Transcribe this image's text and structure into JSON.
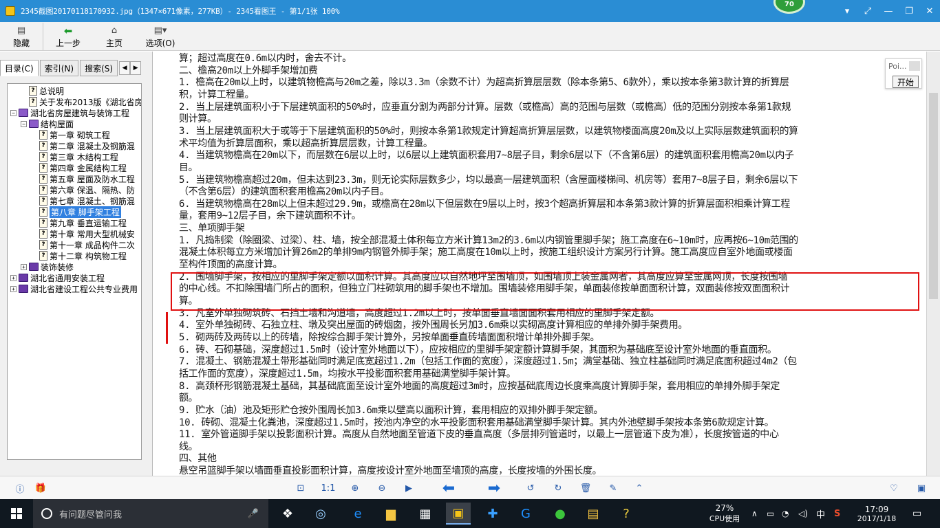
{
  "window": {
    "title": "2345截图20170118170932.jpg（1347×671像素，277KB）- 2345看图王 - 第1/1张 100%",
    "badge": "70",
    "buttons": [
      "▾",
      "⤢",
      "—",
      "❐",
      "✕"
    ]
  },
  "toolbar": [
    {
      "icon": "▤",
      "label": "隐藏"
    },
    {
      "icon": "⬅",
      "label": "上一步"
    },
    {
      "icon": "⌂",
      "label": "主页"
    },
    {
      "icon": "▤▾",
      "label": "选项(O)"
    }
  ],
  "left_tabs": [
    "目录(C)",
    "索引(N)",
    "搜索(S)"
  ],
  "tab_arrows": [
    "◀",
    "▶"
  ],
  "tree": [
    {
      "indent": 1,
      "kind": "q",
      "label": "总说明"
    },
    {
      "indent": 1,
      "kind": "q",
      "label": "关于发布2013版《湖北省房屋"
    },
    {
      "indent": 0,
      "kind": "book",
      "exp": "−",
      "label": "湖北省房屋建筑与装饰工程"
    },
    {
      "indent": 1,
      "kind": "book",
      "exp": "−",
      "label": "结构屋面"
    },
    {
      "indent": 2,
      "kind": "q",
      "label": "第一章  砌筑工程"
    },
    {
      "indent": 2,
      "kind": "q",
      "label": "第二章  混凝土及钢筋混"
    },
    {
      "indent": 2,
      "kind": "q",
      "label": "第三章  木结构工程"
    },
    {
      "indent": 2,
      "kind": "q",
      "label": "第四章  金属结构工程"
    },
    {
      "indent": 2,
      "kind": "q",
      "label": "第五章  屋面及防水工程"
    },
    {
      "indent": 2,
      "kind": "q",
      "label": "第六章  保温、隔热、防"
    },
    {
      "indent": 2,
      "kind": "q",
      "label": "第七章  混凝土、钢筋混"
    },
    {
      "indent": 2,
      "kind": "q",
      "label": "第八章  脚手架工程",
      "selected": true
    },
    {
      "indent": 2,
      "kind": "q",
      "label": "第九章  垂直运输工程"
    },
    {
      "indent": 2,
      "kind": "q",
      "label": "第十章  常用大型机械安"
    },
    {
      "indent": 2,
      "kind": "q",
      "label": "第十一章  成品构件二次"
    },
    {
      "indent": 2,
      "kind": "q",
      "label": "第十二章  构筑物工程"
    },
    {
      "indent": 1,
      "kind": "book",
      "exp": "+",
      "label": "装饰装修"
    },
    {
      "indent": 0,
      "kind": "book",
      "exp": "+",
      "label": "湖北省通用安装工程"
    },
    {
      "indent": 0,
      "kind": "book",
      "exp": "+",
      "label": "湖北省建设工程公共专业费用"
    }
  ],
  "doc_lines": [
    "算；超过高度在0.6m以内时，舍去不计。",
    "二、檐高20m以上外脚手架增加费",
    "1. 檐高在20m以上时，以建筑物檐高与20m之差，除以3.3m（余数不计）为超高折算层层数（除本条第5、6款外），乘以按本条第3款计算的折算层",
    "积，计算工程量。",
    "2. 当上层建筑面积小于下层建筑面积的50%时，应垂直分割为两部分计算。层数（或檐高）高的范围与层数（或檐高）低的范围分别按本条第1款规",
    "则计算。",
    "3. 当上层建筑面积大于或等于下层建筑面积的50%时，则按本条第1款规定计算超高折算层层数，以建筑物楼面高度20m及以上实际层数建筑面积的算",
    "术平均值为折算层面积，乘以超高折算层层数，计算工程量。",
    "4. 当建筑物檐高在20m以下，而层数在6层以上时，以6层以上建筑面积套用7~8层子目，剩余6层以下（不含第6层）的建筑面积套用檐高20m以内子",
    "目。",
    "5. 当建筑物檐高超过20m，但未达到23.3m，则无论实际层数多少，均以最高一层建筑面积（含屋面楼梯间、机房等）套用7~8层子目，剩余6层以下",
    "（不含第6层）的建筑面积套用檐高20m以内子目。",
    "6. 当建筑物檐高在28m以上但未超过29.9m，或檐高在28m以下但层数在9层以上时，按3个超高折算层和本条第3款计算的折算层面积相乘计算工程",
    "量，套用9~12层子目，余下建筑面积不计。",
    "三、单项脚手架",
    "1. 凡捣制梁（除圈梁、过梁）、柱、墙，按全部混凝土体积每立方米计算13m2的3.6m以内钢管里脚手架；施工高度在6~10m时，应再按6~10m范围的",
    "混凝土体积每立方米增加计算26m2的单排9m内钢管外脚手架；施工高度在10m以上时，按施工组织设计方案另行计算。施工高度应自室外地面或楼面",
    "至构件顶面的高度计算。",
    "2. 围墙脚手架，按相应的里脚手架定额以面积计算。其高度应以自然地坪至围墙顶，如围墙顶上装金属网者，其高度应算至金属网顶，长度按围墙",
    "的中心线。不扣除围墙门所占的面积，但独立门柱砌筑用的脚手架也不增加。围墙装修用脚手架，单面装修按单面面积计算，双面装修按双面面积计",
    "算。",
    "3. 凡室外单独砌筑砖、石挡土墙和沟道墙，高度超过1.2m以上时，按单面垂直墙面面积套用相应的里脚手架定额。",
    "4. 室外单独砌砖、石独立柱、墩及突出屋面的砖烟囱，按外围周长另加3.6m乘以实砌高度计算相应的单排外脚手架费用。",
    "5. 砌两砖及两砖以上的砖墙，除按综合脚手架计算外，另按单面垂直砖墙面面积增计单排外脚手架。",
    "6. 砖、石砌基础，深度超过1.5m时（设计室外地面以下），应按相应的里脚手架定额计算脚手架，其面积为基础底至设计室外地面的垂直面积。",
    "7. 混凝土、钢筋混凝土带形基础同时满足底宽超过1.2m（包括工作面的宽度），深度超过1.5m；满堂基础、独立柱基础同时满足底面积超过4m2（包",
    "括工作面的宽度），深度超过1.5m，均按水平投影面积套用基础满堂脚手架计算。",
    "8. 高颈杯形钢筋混凝土基础，其基础底面至设计室外地面的高度超过3m时，应按基础底周边长度乘高度计算脚手架，套用相应的单排外脚手架定",
    "额。",
    "9. 贮水（油）池及矩形贮仓按外围周长加3.6m乘以壁高以面积计算，套用相应的双排外脚手架定额。",
    "10. 砖砌、混凝土化粪池，深度超过1.5m时，按池内净空的水平投影面积套用基础满堂脚手架计算。其内外池壁脚手架按本条第6款规定计算。",
    "11. 室外管道脚手架以投影面积计算。高度从自然地面至管道下皮的垂直高度（多层排列管道时，以最上一层管道下皮为准），长度按管道的中心",
    "线。",
    "四、其他",
    "悬空吊篮脚手架以墙面垂直投影面积计算，高度按设计室外地面至墙顶的高度，长度按墙的外围长度。"
  ],
  "popup": {
    "text": "Poi...",
    "button": "开始"
  },
  "viewer_toolbar": [
    {
      "name": "info-icon",
      "glyph": "ⓘ"
    },
    {
      "name": "gift-icon",
      "glyph": "🎁"
    },
    {
      "name": "fit-icon",
      "glyph": "⊡"
    },
    {
      "name": "actual-size-icon",
      "glyph": "1:1"
    },
    {
      "name": "zoom-in-icon",
      "glyph": "⊕"
    },
    {
      "name": "zoom-out-icon",
      "glyph": "⊖"
    },
    {
      "name": "slideshow-icon",
      "glyph": "▶"
    },
    {
      "name": "prev-icon",
      "glyph": "⬅"
    },
    {
      "name": "next-icon",
      "glyph": "➡"
    },
    {
      "name": "rotate-left-icon",
      "glyph": "↺"
    },
    {
      "name": "rotate-right-icon",
      "glyph": "↻"
    },
    {
      "name": "delete-icon",
      "glyph": "🗑"
    },
    {
      "name": "edit-icon",
      "glyph": "✎"
    },
    {
      "name": "up-icon",
      "glyph": "⌃"
    },
    {
      "name": "heart-icon",
      "glyph": "♡"
    },
    {
      "name": "more-icon",
      "glyph": "▣"
    }
  ],
  "taskbar": {
    "search_placeholder": "有问题尽管问我",
    "apps": [
      {
        "name": "task-view-icon",
        "glyph": "❖",
        "color": "#ffffff"
      },
      {
        "name": "browser-360-icon",
        "glyph": "◎",
        "color": "#9ad0ff"
      },
      {
        "name": "edge-icon",
        "glyph": "e",
        "color": "#1e90ff"
      },
      {
        "name": "folder-icon",
        "glyph": "▆",
        "color": "#f4c542"
      },
      {
        "name": "store-icon",
        "glyph": "▦",
        "color": "#ffffff"
      },
      {
        "name": "image-viewer-icon",
        "glyph": "▣",
        "color": "#f5c518"
      },
      {
        "name": "pinwheel-icon",
        "glyph": "✚",
        "color": "#3aa0ff"
      },
      {
        "name": "g-app-icon",
        "glyph": "G",
        "color": "#1e90ff"
      },
      {
        "name": "green-app-icon",
        "glyph": "●",
        "color": "#3cc63c"
      },
      {
        "name": "notes-app-icon",
        "glyph": "▤",
        "color": "#f0c040"
      },
      {
        "name": "help-app-icon",
        "glyph": "?",
        "color": "#f0d040"
      }
    ],
    "cpu_percent": "27%",
    "cpu_label": "CPU使用",
    "ime": "中",
    "time": "17:09",
    "date": "2017/1/18"
  }
}
